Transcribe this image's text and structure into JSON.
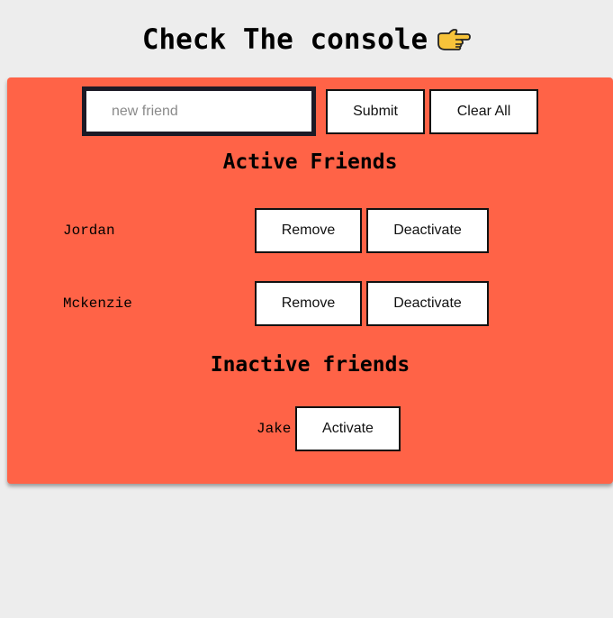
{
  "header": {
    "title": "Check The console",
    "hand_icon": "pointing-right-hand-icon"
  },
  "form": {
    "input_placeholder": "new friend",
    "input_value": "",
    "submit_label": "Submit",
    "clear_label": "Clear All"
  },
  "active_section": {
    "heading": "Active Friends",
    "friends": [
      {
        "name": "Jordan",
        "remove_label": "Remove",
        "deactivate_label": "Deactivate"
      },
      {
        "name": "Mckenzie",
        "remove_label": "Remove",
        "deactivate_label": "Deactivate"
      }
    ]
  },
  "inactive_section": {
    "heading": "Inactive friends",
    "friends": [
      {
        "name": "Jake",
        "activate_label": "Activate"
      }
    ]
  },
  "colors": {
    "page_background": "#ededed",
    "card_background": "#ff6347",
    "hand_fill": "#f7c33a"
  }
}
